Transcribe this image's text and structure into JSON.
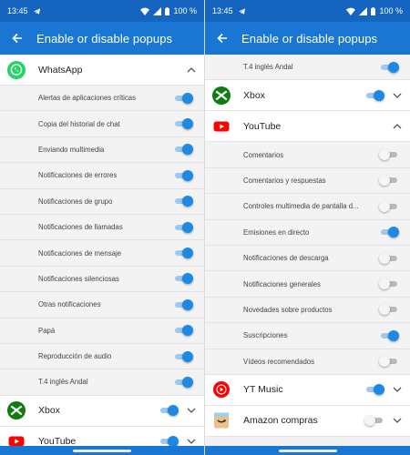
{
  "colors": {
    "statusbar": "#1565c0",
    "appbar": "#1976d2",
    "toggle_on": "#1e88e5",
    "toggle_off": "#f5f5f5"
  },
  "screens": [
    {
      "status": {
        "time": "13:45",
        "battery": "100 %"
      },
      "title": "Enable or disable popups",
      "rows": [
        {
          "kind": "app",
          "name": "WhatsApp",
          "icon": "whatsapp-icon",
          "has_toggle": false,
          "chevron": "up"
        },
        {
          "kind": "sub",
          "label": "Alertas de aplicaciones críticas",
          "on": true
        },
        {
          "kind": "sub",
          "label": "Copia del historial de chat",
          "on": true
        },
        {
          "kind": "sub",
          "label": "Enviando multimedia",
          "on": true
        },
        {
          "kind": "sub",
          "label": "Notificaciones de errores",
          "on": true
        },
        {
          "kind": "sub",
          "label": "Notificaciones de grupo",
          "on": true
        },
        {
          "kind": "sub",
          "label": "Notificaciones de llamadas",
          "on": true
        },
        {
          "kind": "sub",
          "label": "Notificaciones de mensaje",
          "on": true
        },
        {
          "kind": "sub",
          "label": "Notificaciones silenciosas",
          "on": true
        },
        {
          "kind": "sub",
          "label": "Otras notificaciones",
          "on": true
        },
        {
          "kind": "sub",
          "label": "Papá",
          "on": true
        },
        {
          "kind": "sub",
          "label": "Reproducción de audio",
          "on": true
        },
        {
          "kind": "sub",
          "label": "T.4 inglés Andal",
          "on": true
        },
        {
          "kind": "app",
          "name": "Xbox",
          "icon": "xbox-icon",
          "has_toggle": true,
          "on": true,
          "chevron": "down"
        },
        {
          "kind": "app",
          "name": "YouTube",
          "icon": "youtube-icon",
          "has_toggle": true,
          "on": true,
          "chevron": "down"
        }
      ]
    },
    {
      "status": {
        "time": "13:45",
        "battery": "100 %"
      },
      "title": "Enable or disable popups",
      "rows": [
        {
          "kind": "sub",
          "label": "T.4 inglés Andal",
          "on": true
        },
        {
          "kind": "app",
          "name": "Xbox",
          "icon": "xbox-icon",
          "has_toggle": true,
          "on": true,
          "chevron": "down"
        },
        {
          "kind": "app",
          "name": "YouTube",
          "icon": "youtube-icon",
          "has_toggle": false,
          "chevron": "up"
        },
        {
          "kind": "sub",
          "label": "Comentarios",
          "on": false
        },
        {
          "kind": "sub",
          "label": "Comentarios y respuestas",
          "on": false
        },
        {
          "kind": "sub",
          "label": "Controles multimedia de pantalla d...",
          "on": false
        },
        {
          "kind": "sub",
          "label": "Emisiones en directo",
          "on": true
        },
        {
          "kind": "sub",
          "label": "Notificaciones de descarga",
          "on": false
        },
        {
          "kind": "sub",
          "label": "Notificaciones generales",
          "on": false
        },
        {
          "kind": "sub",
          "label": "Novedades sobre productos",
          "on": false
        },
        {
          "kind": "sub",
          "label": "Suscripciones",
          "on": true
        },
        {
          "kind": "sub",
          "label": "Vídeos recomendados",
          "on": false
        },
        {
          "kind": "app",
          "name": "YT Music",
          "icon": "yt-music-icon",
          "has_toggle": true,
          "on": true,
          "chevron": "down"
        },
        {
          "kind": "app",
          "name": "Amazon compras",
          "icon": "amazon-icon",
          "has_toggle": true,
          "on": false,
          "chevron": "down"
        }
      ]
    }
  ]
}
